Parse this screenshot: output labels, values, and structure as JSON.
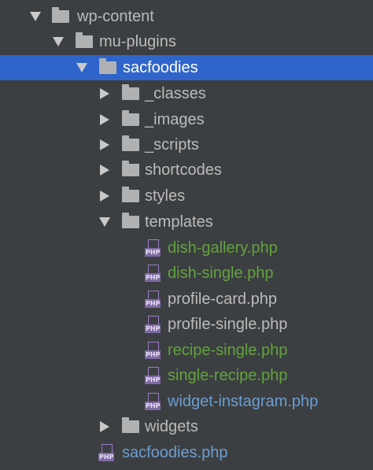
{
  "tree": {
    "wp_content": "wp-content",
    "mu_plugins": "mu-plugins",
    "sacfoodies": "sacfoodies",
    "classes": "_classes",
    "images": "_images",
    "scripts": "_scripts",
    "shortcodes": "shortcodes",
    "styles": "styles",
    "templates": "templates",
    "php_tag": "PHP",
    "files": {
      "dish_gallery": "dish-gallery.php",
      "dish_single": "dish-single.php",
      "profile_card": "profile-card.php",
      "profile_single": "profile-single.php",
      "recipe_single": "recipe-single.php",
      "single_recipe": "single-recipe.php",
      "widget_instagram": "widget-instagram.php"
    },
    "widgets": "widgets",
    "sacfoodies_php": "sacfoodies.php"
  },
  "colors": {
    "background": "#3c3f41",
    "selection": "#2f65ca",
    "text_default": "#bbbbbb",
    "text_added": "#62a33e",
    "text_modified": "#6c9dd2",
    "php_icon": "#7e6aa3"
  },
  "icons": {
    "expanded": "chevron-down-icon",
    "collapsed": "chevron-right-icon",
    "folder": "folder-icon",
    "php_file": "php-file-icon"
  }
}
